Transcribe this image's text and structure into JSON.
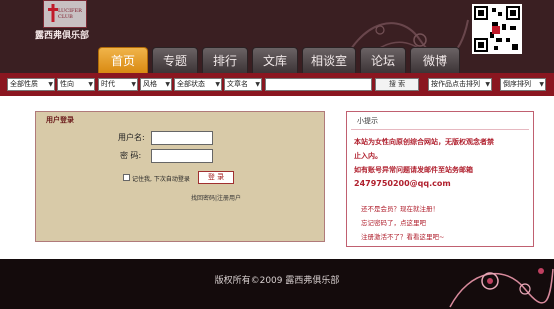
{
  "brand": {
    "logo_en": "LUCIFER CLUB",
    "logo_cn": "露西弗俱乐部"
  },
  "nav": {
    "tabs": [
      "首页",
      "专题",
      "排行",
      "文库",
      "相谈室",
      "论坛",
      "微博"
    ],
    "active": 0
  },
  "search": {
    "filters": [
      "全部性质",
      "性向",
      "时代",
      "风格",
      "全部状态",
      "文章名"
    ],
    "button": "搜 索",
    "sort_1": "按作品点击排列",
    "sort_2": "倒序排列"
  },
  "login": {
    "title": "用户登录",
    "username_label": "用户名:",
    "password_label": "密  码:",
    "remember_label": "记住我, 下次自动登录",
    "submit": "登 录",
    "links": "找回密码|注册用户"
  },
  "tips": {
    "title": "小提示",
    "lines": [
      "本站为女性向原创综合网站，无版权观念者禁",
      "止入内。",
      "如有账号异常问题请发邮件至站务邮箱",
      "2479750200@qq.com"
    ],
    "links": [
      "还不是会员？现在就注册！",
      "忘记密码了，点这里吧",
      "注册激活不了？看看这里吧~"
    ]
  },
  "footer": {
    "copyright": "版权所有©2009 露西弗俱乐部"
  },
  "colors": {
    "header_bg": "#3a1f22",
    "search_bar": "#8a1620",
    "tab_active": "#e09a20",
    "login_bg": "#d8caa8",
    "accent_red": "#b0202e",
    "footer_bg": "#140b0c"
  }
}
